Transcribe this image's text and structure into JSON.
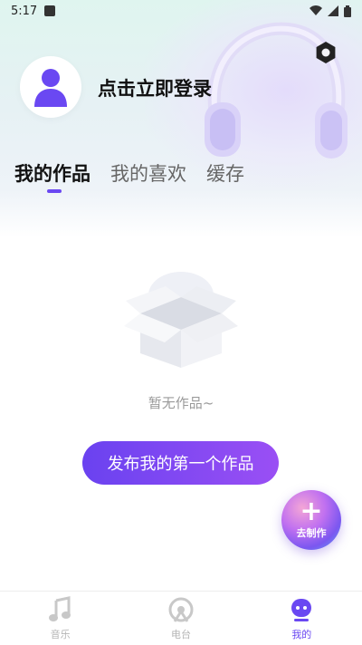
{
  "status_bar": {
    "time": "5:17"
  },
  "profile": {
    "login_prompt": "点击立即登录"
  },
  "tabs": [
    {
      "label": "我的作品",
      "active": true
    },
    {
      "label": "我的喜欢",
      "active": false
    },
    {
      "label": "缓存",
      "active": false
    }
  ],
  "empty_state": {
    "message": "暂无作品~",
    "publish_button": "发布我的第一个作品"
  },
  "fab": {
    "label": "去制作",
    "icon": "plus-icon"
  },
  "bottom_nav": [
    {
      "label": "音乐",
      "icon": "music-note-icon",
      "active": false
    },
    {
      "label": "电台",
      "icon": "radio-icon",
      "active": false
    },
    {
      "label": "我的",
      "icon": "profile-bot-icon",
      "active": true
    }
  ],
  "colors": {
    "accent": "#6a48f2",
    "button_gradient_start": "#6a42f0",
    "button_gradient_end": "#9a4ff4"
  }
}
